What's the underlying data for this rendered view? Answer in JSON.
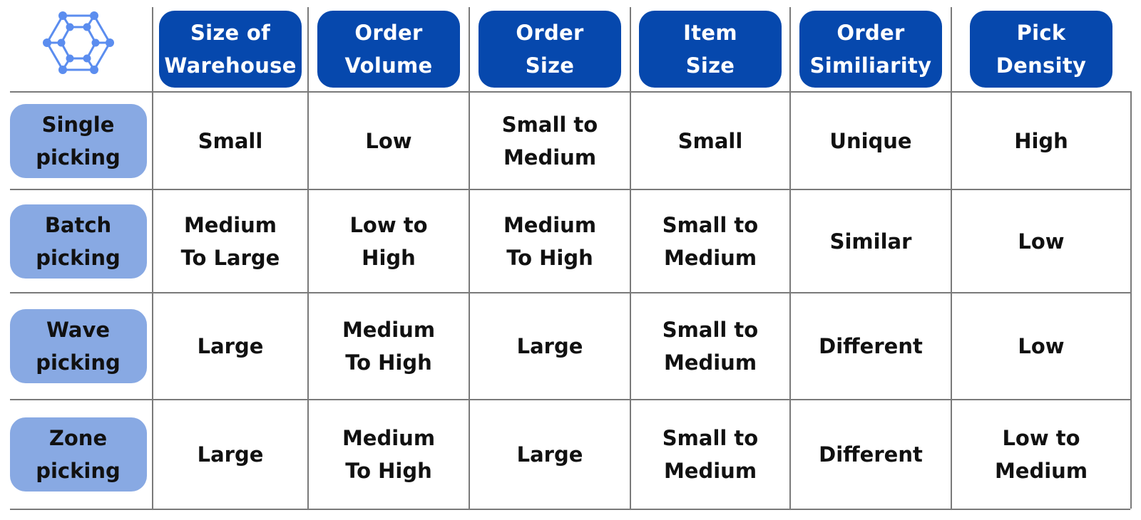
{
  "logo": {
    "icon": "hexagon-network-icon",
    "color": "#5b8def"
  },
  "colors": {
    "header_pill": "#0648ad",
    "row_pill": "#88a9e3",
    "grid": "#7a7a7a"
  },
  "columns": [
    {
      "label": "Size of\nWarehouse"
    },
    {
      "label": "Order\nVolume"
    },
    {
      "label": "Order\nSize"
    },
    {
      "label": "Item\nSize"
    },
    {
      "label": "Order\nSimiliarity"
    },
    {
      "label": "Pick\nDensity"
    }
  ],
  "rows": [
    {
      "label": "Single\npicking",
      "cells": [
        "Small",
        "Low",
        "Small to\nMedium",
        "Small",
        "Unique",
        "High"
      ]
    },
    {
      "label": "Batch\npicking",
      "cells": [
        "Medium\nTo Large",
        "Low to\nHigh",
        "Medium\nTo High",
        "Small to\nMedium",
        "Similar",
        "Low"
      ]
    },
    {
      "label": "Wave\npicking",
      "cells": [
        "Large",
        "Medium\nTo High",
        "Large",
        "Small to\nMedium",
        "Different",
        "Low"
      ]
    },
    {
      "label": "Zone\npicking",
      "cells": [
        "Large",
        "Medium\nTo High",
        "Large",
        "Small to\nMedium",
        "Different",
        "Low to\nMedium"
      ]
    }
  ]
}
